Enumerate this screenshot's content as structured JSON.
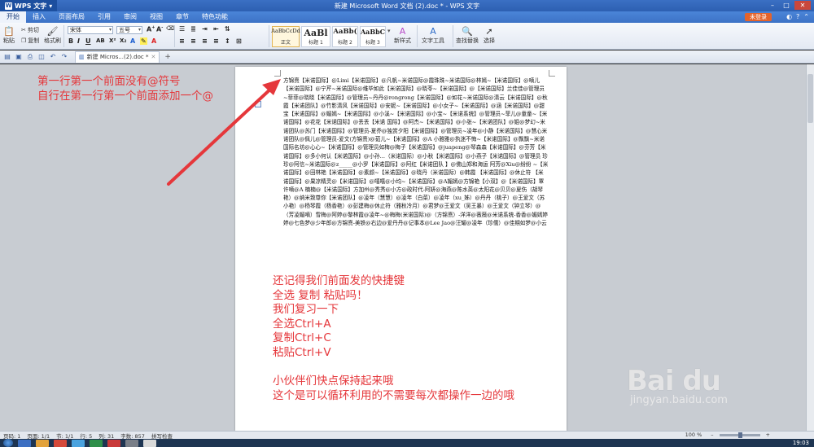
{
  "app": {
    "name": "WPS 文字",
    "window_title": "新建 Microsoft Word 文档 (2).doc * - WPS 文字"
  },
  "menu": {
    "items": [
      "开始",
      "插入",
      "页面布局",
      "引用",
      "审阅",
      "视图",
      "章节",
      "特色功能"
    ],
    "active_index": 0,
    "login_label": "未登录"
  },
  "ribbon": {
    "paste": "粘贴",
    "cut": "剪切",
    "copy": "复制",
    "format_painter": "格式刷",
    "font_name": "宋体",
    "font_size": "五号",
    "styles": [
      {
        "sample": "AaBbCcDd",
        "name": "正文"
      },
      {
        "sample": "AaBl",
        "name": "标题 1"
      },
      {
        "sample": "AaBb(",
        "name": "标题 2"
      },
      {
        "sample": "AaBbC",
        "name": "标题 3"
      }
    ],
    "new_style": "新样式",
    "text_tools": "文字工具",
    "find_replace": "查找替换",
    "select": "选择"
  },
  "tabs": {
    "doc_tab": "新建 Micros...(2).doc *"
  },
  "document": {
    "body": "方锦熹【米诺国际】@Limi【米诺国际】@凡帆~米诺国际@霞珠珠~米诺国际@林嫣~【米诺国际】@嘀儿【米诺国际】@宁芹~米诺国际@维毕如此【米诺国际】@晓苓~【米诺国际】@【米诺国际】兰佳佳@管理员~菲菲@晓晓【米诺国际】@管理员~丹丹@rongrong【米诺国际】@如花~米诺国际@清云【米诺国际】@秋霞【米诺团队】@竹影清风【米诺国际】@安妮~【米诺国际】@小女子~【米诺国际】@涵【米诺国际】@甜宝【米诺国际】@媚嫣~【米诺国际】@小溪~【米诺国际】@小宝~【米诺系统】@管理员~菲儿@童童~【米诺国际】@花花【米诺国际】@丢丢【米诺 国际】@阿杰~【米诺国际】@小张~【米诺团队】@姐@梦幻~米诺团队@苏门【米诺国际】@管理员-夏乔@独赏夕阳【米诺国际】@管理员~凌年@小静【米诺国际】@慧心米诺团队@佩儿@管理员-爱文(方锦熹)@茹儿~【米诺国际】@A 小雅雅@执迷不悔~【米诺国际】@飘飘~米诺国际名坊@心心~【米诺国际】@管理员如梅@梅子【米诺国际】@juapeng@琴森森【米诺国际】@芬芳【米诺国际】@多小何认【米诺国际】@小孙...（米诺国际）@小秋【米诺国际】@小燕子【米诺国际】@管理员 珍珍@阿信~米诺国际@z_____@小罗【米诺国际】@阿红【米诺团队 】@佛山郑和海运 阿芳@Xiu@纷纷 ~【米诺国际】@田林艳【米诺国际】@素颜~【米诺国际】@晓丹（米诺国际）@韩霞 【米诺国际】@休止符 【米诺国际】@果凉精灵@【米诺国际】@嘻嘻@小均~【米诺国际】@A媚嫣@方锦艳【小双】@【米诺国际】覃许嘀@A 楠楠@【米诺国际】方加州@秀秀@小方@政时代-阿妍@海燕@陈水英@太阳花@贝贝@夏伤（胡琴艳）@纳米致尊你【米诺团队】@凌年（慧慧）@凌年（白菜）@凌年（xu_姊）@丹丹（桃子）@王爱文（苏小艳）@杨琴霞（杨香艳）@彭建梅@休止符（雅秋冷月）@君梦@王爱文（吴王暴）@王爱文（钟立琴）@（芳凌媚嘀）雪梅@阿婷@黎林霞@凌年~@梅梅(米诺国际)@（方锦熹）-洋洋@薇薇@米诺系统-香香@媚嫣婷婷@七色梦@少年郎@方锦熹-美铁@右边@爱丹丹@记事本@Lee Jao@汪耀@凌年（珍儒）@佳期如梦@小云"
  },
  "annotations": {
    "left": [
      "第一行第一个前面没有@符号",
      "自行在第一行第一个前面添加一个@"
    ],
    "middle": [
      "还记得我们前面发的快捷键",
      "全选 复制 粘贴吗！",
      "我们复习一下",
      "全选Ctrl+A",
      "复制Ctrl+C",
      "粘贴Ctrl+V"
    ],
    "bottom": [
      "小伙伴们快点保持起来哦",
      "这个是可以循环利用的不需要每次都操作一边的哦"
    ],
    "color": "#e5373b"
  },
  "watermark": {
    "logo": "Bai du",
    "site": "jingyan.baidu.com"
  },
  "status": {
    "page": "页码: 1",
    "pages": "页面: 1/1",
    "section": "节: 1/1",
    "line": "行: 5",
    "column": "列: 31",
    "words": "字数: 857",
    "spell": "拼写检查",
    "zoom": "100 %"
  },
  "taskbar": {
    "clock": "19:03"
  }
}
